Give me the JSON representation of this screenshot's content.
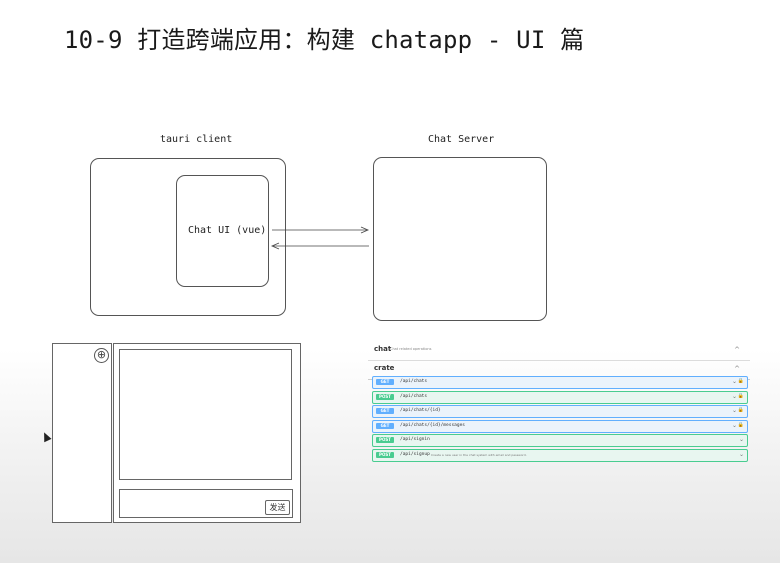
{
  "title": "10-9 打造跨端应用：构建 chatapp - UI 篇",
  "diagram": {
    "tauri_label": "tauri client",
    "server_label": "Chat Server",
    "ui_label": "Chat UI (vue)"
  },
  "wireframe": {
    "plus_icon": "⊕",
    "send_button": "发送"
  },
  "swagger": {
    "sections": [
      {
        "name": "chat",
        "description": "Chat related operations",
        "chevron": "^"
      },
      {
        "name": "crate",
        "description": "",
        "chevron": "^"
      }
    ],
    "endpoints": [
      {
        "method": "GET",
        "path": "/api/chats",
        "description": "",
        "locked": true
      },
      {
        "method": "POST",
        "path": "/api/chats",
        "description": "",
        "locked": true
      },
      {
        "method": "GET",
        "path": "/api/chats/{id}",
        "description": "",
        "locked": true
      },
      {
        "method": "GET",
        "path": "/api/chats/{id}/messages",
        "description": "",
        "locked": true
      },
      {
        "method": "POST",
        "path": "/api/signin",
        "description": "",
        "locked": false
      },
      {
        "method": "POST",
        "path": "/api/signup",
        "description": "Create a new user in the chat system with email and password.",
        "locked": false
      }
    ],
    "colors": {
      "get": "#61affe",
      "post": "#49cc90"
    }
  }
}
